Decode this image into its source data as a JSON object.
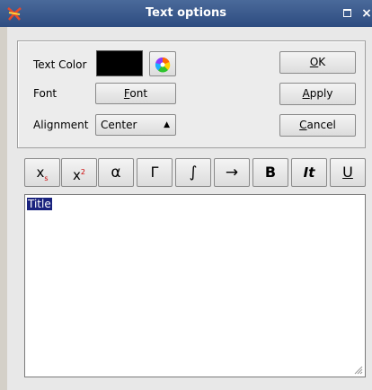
{
  "window": {
    "title": "Text options"
  },
  "labels": {
    "text_color": "Text Color",
    "font": "Font",
    "alignment": "Alignment"
  },
  "buttons": {
    "font": "Font",
    "ok": "OK",
    "apply": "Apply",
    "cancel": "Cancel"
  },
  "alignment_select": {
    "value": "Center"
  },
  "text_color": {
    "value": "#000000"
  },
  "format_toolbar": {
    "subscript": "x",
    "superscript": "x",
    "alpha": "α",
    "gamma": "Γ",
    "integral": "∫",
    "arrow": "→",
    "bold": "B",
    "italic": "It",
    "underline": "U"
  },
  "editor": {
    "content": "Title"
  }
}
